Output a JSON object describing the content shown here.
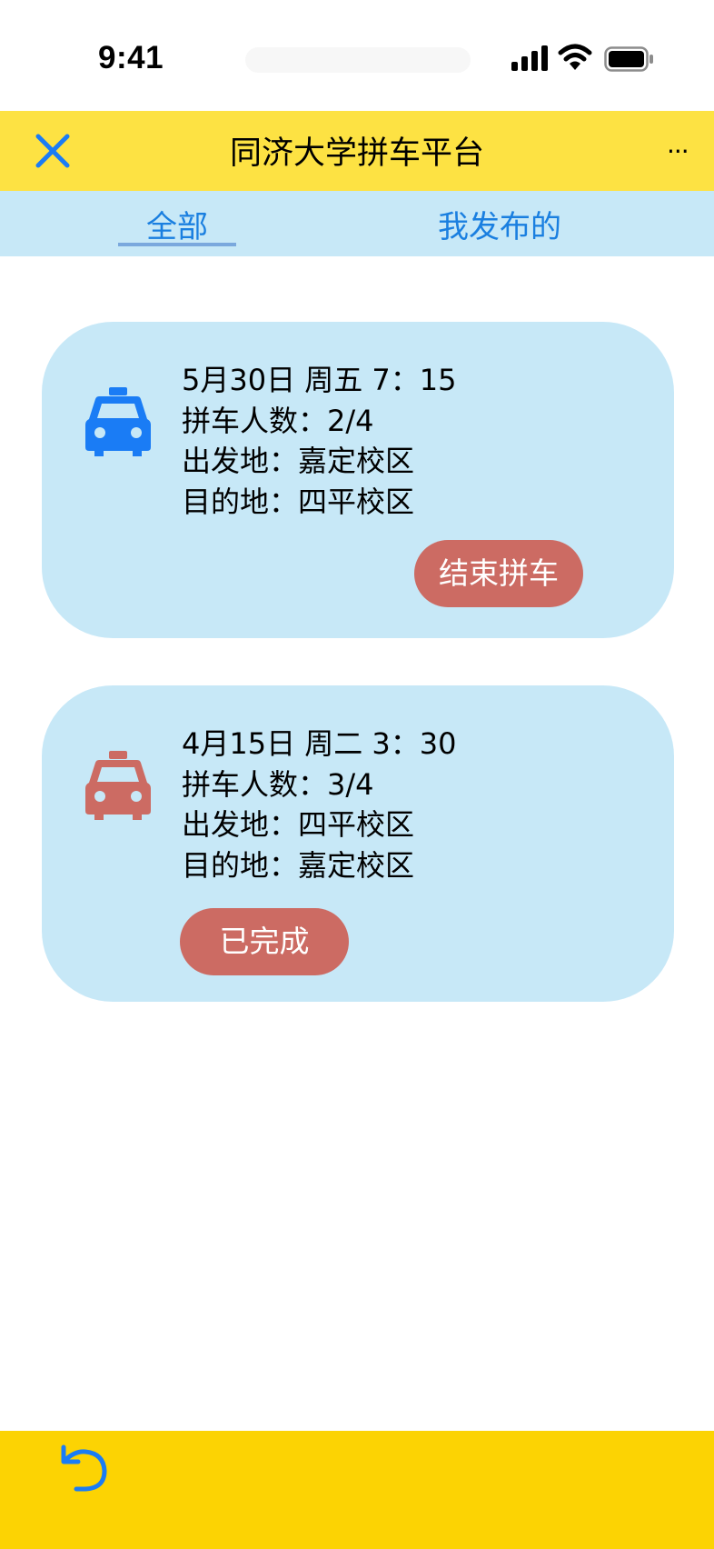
{
  "status_bar": {
    "time": "9:41"
  },
  "header": {
    "title": "同济大学拼车平台",
    "more_label": "···"
  },
  "tabs": [
    {
      "label": "全部",
      "active": true
    },
    {
      "label": "我发布的",
      "active": false
    }
  ],
  "trips": [
    {
      "datetime": "5月30日 周五 7：15",
      "passengers": "拼车人数：2/4",
      "origin": "出发地：嘉定校区",
      "destination": "目的地：四平校区",
      "action_label": "结束拼车",
      "icon": "taxi-icon",
      "icon_color": "#1a7cf5"
    },
    {
      "datetime": "4月15日 周二 3：30",
      "passengers": "拼车人数：3/4",
      "origin": "出发地：四平校区",
      "destination": "目的地：嘉定校区",
      "status_label": "已完成",
      "icon": "taxi-icon",
      "icon_color": "#cc6b63"
    }
  ],
  "colors": {
    "header_bg": "#fde243",
    "tab_bg": "#c7e8f7",
    "card_bg": "#c7e8f7",
    "accent_blue": "#1a7fe0",
    "button_red": "#cc6b63",
    "footer_bg": "#fcd303"
  }
}
